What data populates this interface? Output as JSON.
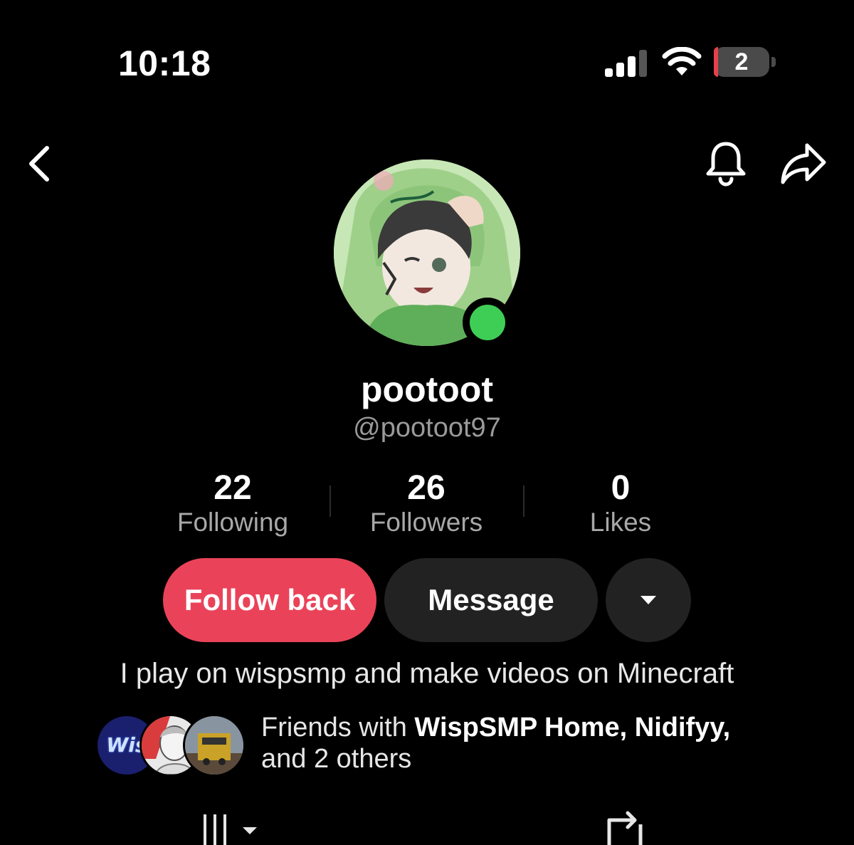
{
  "status_bar": {
    "time": "10:18",
    "battery_level": "2"
  },
  "profile": {
    "display_name": "pootoot",
    "handle": "@pootoot97",
    "online": true
  },
  "stats": [
    {
      "value": "22",
      "label": "Following"
    },
    {
      "value": "26",
      "label": "Followers"
    },
    {
      "value": "0",
      "label": "Likes"
    }
  ],
  "actions": {
    "follow_back": "Follow back",
    "message": "Message"
  },
  "bio": "I play on wispsmp and make videos on Minecraft",
  "friends": {
    "prefix": "Friends with ",
    "names": "WispSMP Home, Nidifyy,",
    "suffix": "and 2 others",
    "avatar_badge": "Wis"
  },
  "colors": {
    "accent": "#ea4359",
    "online": "#3fce55",
    "button_dark": "#222222",
    "battery_low": "#e8404a"
  },
  "icons": [
    "back-icon",
    "bell-icon",
    "share-icon",
    "chevron-down-icon",
    "grid-icon",
    "repost-icon"
  ]
}
